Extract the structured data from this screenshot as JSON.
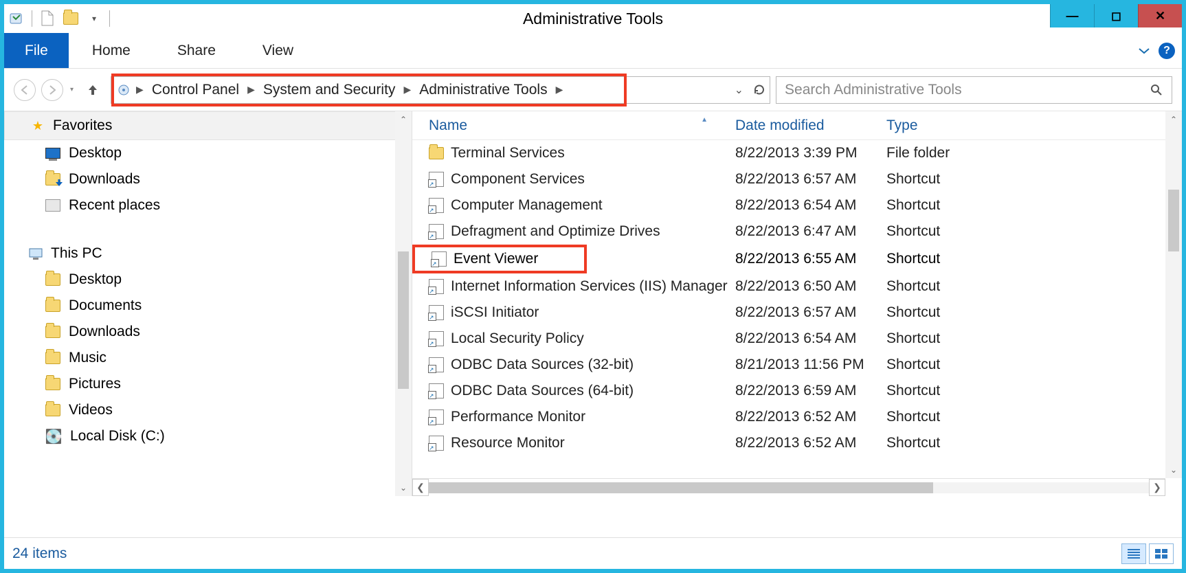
{
  "window": {
    "title": "Administrative Tools"
  },
  "ribbon": {
    "file": "File",
    "tabs": [
      "Home",
      "Share",
      "View"
    ]
  },
  "breadcrumb": {
    "segments": [
      "Control Panel",
      "System and Security",
      "Administrative Tools"
    ]
  },
  "search": {
    "placeholder": "Search Administrative Tools"
  },
  "navpane": {
    "favorites": {
      "label": "Favorites",
      "items": [
        {
          "icon": "desktop-icon",
          "label": "Desktop"
        },
        {
          "icon": "downloads-icon",
          "label": "Downloads"
        },
        {
          "icon": "recent-icon",
          "label": "Recent places"
        }
      ]
    },
    "thispc": {
      "label": "This PC",
      "items": [
        {
          "icon": "folder-icon",
          "label": "Desktop"
        },
        {
          "icon": "folder-icon",
          "label": "Documents"
        },
        {
          "icon": "folder-icon",
          "label": "Downloads"
        },
        {
          "icon": "folder-icon",
          "label": "Music"
        },
        {
          "icon": "folder-icon",
          "label": "Pictures"
        },
        {
          "icon": "folder-icon",
          "label": "Videos"
        },
        {
          "icon": "disk-icon",
          "label": "Local Disk (C:)"
        }
      ]
    }
  },
  "columns": {
    "name": "Name",
    "date": "Date modified",
    "type": "Type"
  },
  "files": [
    {
      "name": "Terminal Services",
      "date": "8/22/2013 3:39 PM",
      "type": "File folder",
      "icon": "folder-icon"
    },
    {
      "name": "Component Services",
      "date": "8/22/2013 6:57 AM",
      "type": "Shortcut",
      "icon": "shortcut-icon"
    },
    {
      "name": "Computer Management",
      "date": "8/22/2013 6:54 AM",
      "type": "Shortcut",
      "icon": "shortcut-icon"
    },
    {
      "name": "Defragment and Optimize Drives",
      "date": "8/22/2013 6:47 AM",
      "type": "Shortcut",
      "icon": "shortcut-icon"
    },
    {
      "name": "Event Viewer",
      "date": "8/22/2013 6:55 AM",
      "type": "Shortcut",
      "icon": "shortcut-icon",
      "highlighted": true
    },
    {
      "name": "Internet Information Services (IIS) Manager",
      "date": "8/22/2013 6:50 AM",
      "type": "Shortcut",
      "icon": "shortcut-icon"
    },
    {
      "name": "iSCSI Initiator",
      "date": "8/22/2013 6:57 AM",
      "type": "Shortcut",
      "icon": "shortcut-icon"
    },
    {
      "name": "Local Security Policy",
      "date": "8/22/2013 6:54 AM",
      "type": "Shortcut",
      "icon": "shortcut-icon"
    },
    {
      "name": "ODBC Data Sources (32-bit)",
      "date": "8/21/2013 11:56 PM",
      "type": "Shortcut",
      "icon": "shortcut-icon"
    },
    {
      "name": "ODBC Data Sources (64-bit)",
      "date": "8/22/2013 6:59 AM",
      "type": "Shortcut",
      "icon": "shortcut-icon"
    },
    {
      "name": "Performance Monitor",
      "date": "8/22/2013 6:52 AM",
      "type": "Shortcut",
      "icon": "shortcut-icon"
    },
    {
      "name": "Resource Monitor",
      "date": "8/22/2013 6:52 AM",
      "type": "Shortcut",
      "icon": "shortcut-icon"
    }
  ],
  "status": {
    "count_label": "24 items"
  }
}
